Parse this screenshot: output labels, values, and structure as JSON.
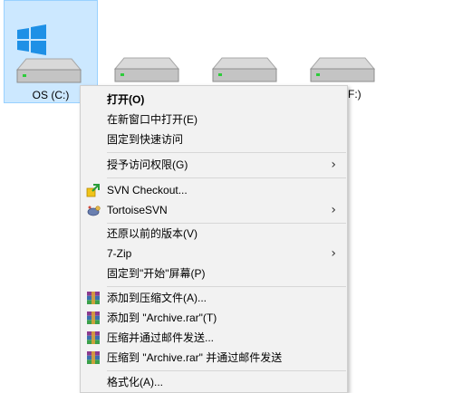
{
  "drives": [
    {
      "label": "OS (C:)",
      "selected": true
    },
    {
      "label": ""
    },
    {
      "label": ""
    },
    {
      "label": "(F:)"
    }
  ],
  "context_menu": {
    "open": "打开(O)",
    "open_new_window": "在新窗口中打开(E)",
    "pin_quick_access": "固定到快速访问",
    "grant_access": "授予访问权限(G)",
    "svn_checkout": "SVN Checkout...",
    "tortoise_svn": "TortoiseSVN",
    "restore_previous": "还原以前的版本(V)",
    "seven_zip": "7-Zip",
    "pin_start": "固定到\"开始\"屏幕(P)",
    "add_to_archive": "添加到压缩文件(A)...",
    "add_to_archive_rar": "添加到 \"Archive.rar\"(T)",
    "compress_email": "压缩并通过邮件发送...",
    "compress_rar_email": "压缩到 \"Archive.rar\" 并通过邮件发送",
    "format": "格式化(A)..."
  }
}
